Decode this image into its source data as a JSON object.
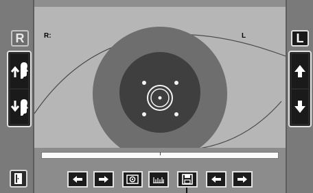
{
  "viewport": {
    "right_eye_label": "R:",
    "left_eye_label": "L"
  },
  "badges": {
    "right": "R",
    "left": "L"
  },
  "left_controls": {
    "top_icon": "move-head-up-icon",
    "bottom_icon": "move-head-down-icon",
    "exit_icon": "exit-door-icon"
  },
  "right_controls": {
    "top_icon": "arrow-up-icon",
    "bottom_icon": "arrow-down-icon"
  },
  "progress": {
    "value": 0.0,
    "marker": 0.5
  },
  "toolbar": {
    "buttons": [
      {
        "icon": "arrow-left-icon"
      },
      {
        "icon": "arrow-right-icon"
      },
      {
        "icon": "camera-icon"
      },
      {
        "icon": "ruler-icon"
      },
      {
        "icon": "save-icon"
      },
      {
        "icon": "arrow-left-icon"
      },
      {
        "icon": "arrow-right-icon"
      }
    ]
  },
  "colors": {
    "background": "#b6b6b6",
    "iris": "#6e6e6e",
    "pupil": "#3f3f3f",
    "button": "#1c1c1c",
    "button_border": "#e3e3e3"
  }
}
